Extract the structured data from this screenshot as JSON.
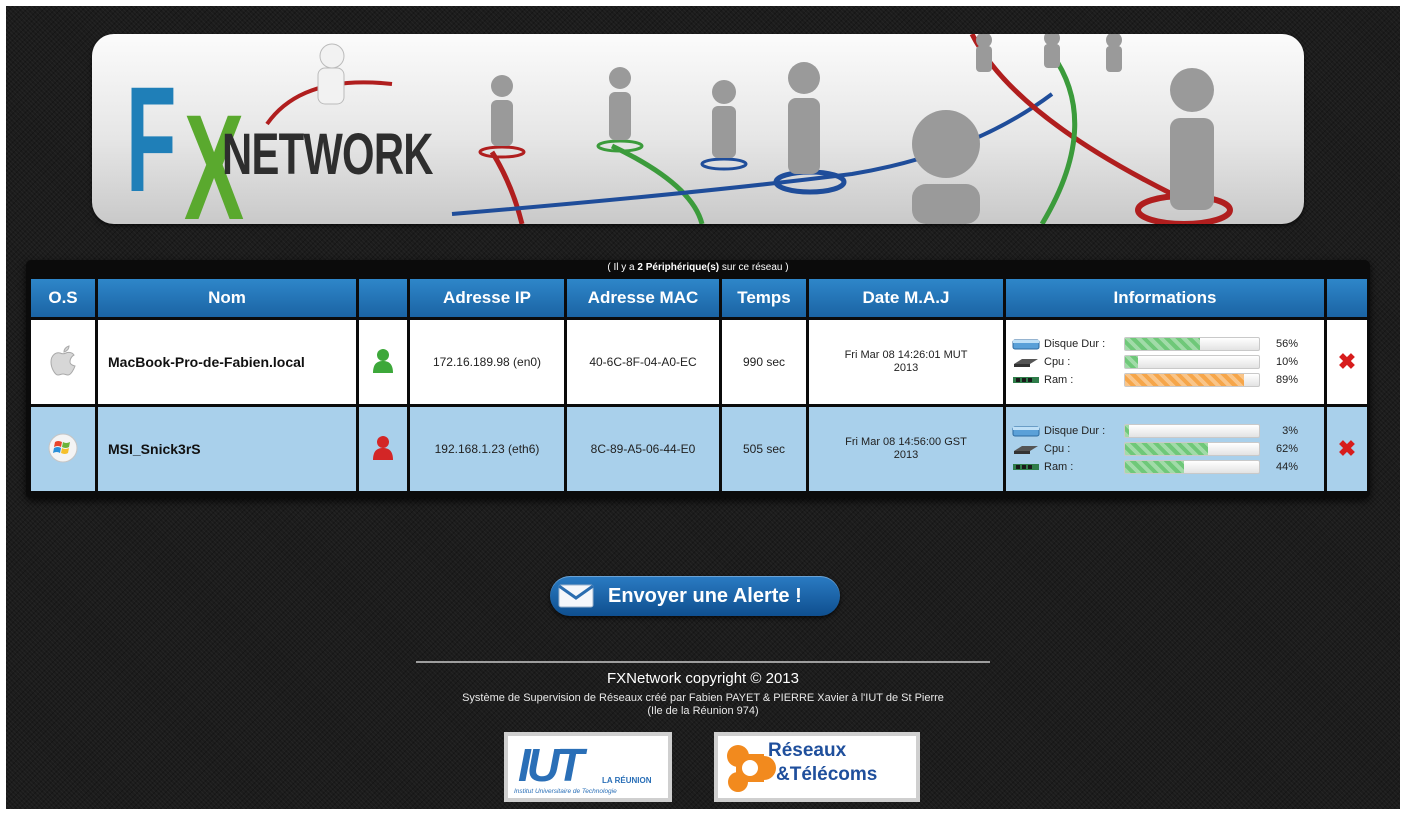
{
  "banner": {
    "logo_f": "F",
    "logo_x": "X",
    "logo_text": "NETWORK"
  },
  "table": {
    "caption_prefix": "( Il y a ",
    "caption_count": "2",
    "caption_bold": " Périphérique(s)",
    "caption_suffix": " sur ce réseau )",
    "headers": {
      "os": "O.S",
      "nom": "Nom",
      "status": "",
      "ip": "Adresse IP",
      "mac": "Adresse MAC",
      "temps": "Temps",
      "date": "Date M.A.J",
      "info": "Informations",
      "action": ""
    },
    "rows": [
      {
        "os_icon": "apple-icon",
        "name": "MacBook-Pro-de-Fabien.local",
        "status_icon": "user-online-icon",
        "status_color": "#3da83a",
        "ip": "172.16.189.98 (en0)",
        "mac": "40-6C-8F-04-A0-EC",
        "temps": "990 sec",
        "date_line1": "Fri Mar 08 14:26:01 MUT",
        "date_line2": "2013",
        "disk_label": "Disque Dur :",
        "disk_pct": "56%",
        "disk_value": 56,
        "cpu_label": "Cpu :",
        "cpu_pct": "10%",
        "cpu_value": 10,
        "ram_label": "Ram :",
        "ram_pct": "89%",
        "ram_value": 89,
        "ram_color": "orange"
      },
      {
        "os_icon": "windows-icon",
        "name": "MSI_Snick3rS",
        "status_icon": "user-offline-icon",
        "status_color": "#d32626",
        "ip": "192.168.1.23 (eth6)",
        "mac": "8C-89-A5-06-44-E0",
        "temps": "505 sec",
        "date_line1": "Fri Mar 08 14:56:00 GST",
        "date_line2": "2013",
        "disk_label": "Disque Dur :",
        "disk_pct": "3%",
        "disk_value": 3,
        "cpu_label": "Cpu :",
        "cpu_pct": "62%",
        "cpu_value": 62,
        "ram_label": "Ram :",
        "ram_pct": "44%",
        "ram_value": 44,
        "ram_color": "green"
      }
    ]
  },
  "alert_button": {
    "label": "Envoyer une Alerte !"
  },
  "footer": {
    "copyright": "FXNetwork  copyright © 2013",
    "credits_line1": "Système de Supervision de Réseaux créé par Fabien PAYET & PIERRE Xavier à l'IUT de St Pierre",
    "credits_line2": "(Ile de la Réunion 974)",
    "iut_logo_text": "IUT",
    "iut_logo_sub1": "LA RÉUNION",
    "iut_logo_sub2": "Institut Universitaire de Technologie",
    "rt_logo_line1": "Réseaux",
    "rt_logo_line2": "&Télécoms"
  },
  "colors": {
    "header_blue": "#2279bd",
    "row_alt": "#a9d0eb",
    "bar_green": "#6fc879",
    "bar_orange": "#f6a64a",
    "delete_red": "#d71c1c"
  }
}
